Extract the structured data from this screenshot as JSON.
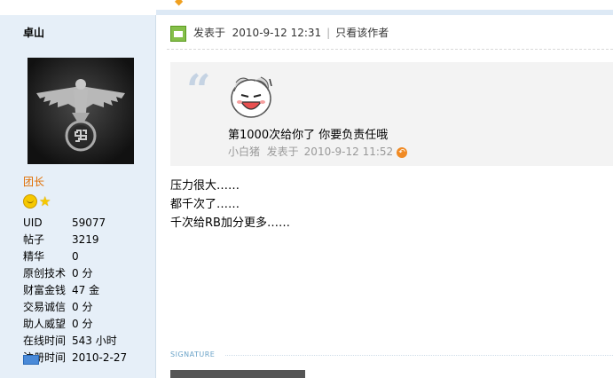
{
  "author": {
    "name": "卓山",
    "rank": "团长",
    "stats": [
      {
        "label": "UID",
        "value": "59077"
      },
      {
        "label": "帖子",
        "value": "3219"
      },
      {
        "label": "精华",
        "value": "0"
      },
      {
        "label": "原创技术",
        "value": "0 分"
      },
      {
        "label": "财富金钱",
        "value": "47 金"
      },
      {
        "label": "交易诚信",
        "value": "0 分"
      },
      {
        "label": "助人威望",
        "value": "0 分"
      },
      {
        "label": "在线时间",
        "value": "543 小时"
      },
      {
        "label": "注册时间",
        "value": "2010-2-27"
      }
    ]
  },
  "post": {
    "posted_label": "发表于",
    "posted_time": "2010-9-12 12:31",
    "separator": "|",
    "only_author_link": "只看该作者",
    "quote": {
      "text": "第1000次给你了  你要负责任哦",
      "author": "小白猪",
      "posted_label": "发表于",
      "time": "2010-9-12 11:52"
    },
    "body": [
      "压力很大……",
      "都千次了……",
      "千次给RB加分更多……"
    ],
    "signature_label": "SIGNATURE"
  },
  "colors": {
    "sidebar_bg": "#e6eff8",
    "rank_color": "#e06e00",
    "quote_bg": "#f3f3f3"
  }
}
